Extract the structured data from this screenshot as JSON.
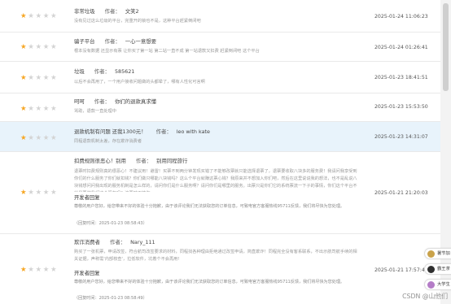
{
  "labels": {
    "author": "作者：",
    "reply_heading": "开发者回复"
  },
  "colors": {
    "star_on": "#f6a623",
    "star_off": "#d3d3d3",
    "highlight": "#e8f3fb"
  },
  "reviews": [
    {
      "rating": 1,
      "title": "非常垃圾",
      "author": "文笑2",
      "body": "没有见过这么垃圾的平台，完重开的锁也不是，这种平台赶紧倒闭吧",
      "date": "2025-01-24 11:06:23"
    },
    {
      "rating": 1,
      "title": "骗子平台",
      "author": "一心一意想要",
      "body": "根本没有数据 还显示有票 让你买了第一站 第二站一直不成 第一站退款又扣费 赶紧倒闭吧 这个平台",
      "date": "2025-01-24 01:26:41"
    },
    {
      "rating": 1,
      "title": "垃圾",
      "author": "585621",
      "body": "以后不会再用了，一个用户接收问题做的头都晕了，哪有人性化可言啊",
      "date": "2025-01-23 18:41:51"
    },
    {
      "rating": 1,
      "title": "呵呵",
      "author": "你们的退款真求懂",
      "body": "骂助，退款一直处理中",
      "date": "2025-01-23 15:53:50"
    },
    {
      "rating": 1,
      "title": "退款机制有问题 还我1300元！",
      "author": "leo with kate",
      "body": "同程退款机制太差，存在欺诈消费者",
      "date": "2025-01-23 14:31:07"
    },
    {
      "rating": 1,
      "title": "扣费规则很恶心！别用",
      "author": "别用同程旅行",
      "body": "退票时扣费规则真的很恶心！不建议用！避雷！买票不到两分钟发现买错了不能够改票就只能选择退票了，退票要收取八块多的服务费！我请问我享受到你们的什么服务了你们就扣钱？你们做只哪能八块钱吗？这么个平台就赚这票心钱？我原来并不想加入你们吧，然后在这里说说我的想法，也不是乱说八块钱想问问我出现的服务机制是怎么样的，请问你们是什么服务啊？请问你们是哪里的服务。出票只是你们它的系统票流一下子的事情，你们这个平台不就是要做我们这个服务吗？流票时不够你",
      "date": "2025-01-21 21:20:03",
      "reply": {
        "body": "尊敬的用户您好，给您带来不好的体验十分抱歉，由于该评论我们无法获取您的订单信息，可致电官方客服热线95711反馈，我们将尽快为您处理。",
        "time": "（回复时间：2025-01-23 08:58:43）"
      }
    },
    {
      "rating": 1,
      "title": "欺诈消费者",
      "author": "Nary_111",
      "body": "购买了一张机票，申请改签，符合航司改签要求的材料，同程找各种理由拒绝通过改签申请，简直欺诈！同程完全没有客系联系，不出示航司航手续的相关证据，声称需'内部核查'，拉低软件，坑着个不会再用!",
      "date": "2025-01-21 17:57:45",
      "reply": {
        "body": "尊敬的用户您好，给您带来不好的体验十分抱歉，由于该评论我们无法获取您的订单信息，可致电官方客服热线95711反馈，我们将尽快为您处理。",
        "time": "（回复时间：2025-01-23 08:58:49）"
      }
    }
  ],
  "side_widgets": [
    {
      "text": "暑节加",
      "avatar_color": "#c9a24a"
    },
    {
      "text": "霸王茶",
      "avatar_color": "#2f2f2f"
    },
    {
      "text": "大学生",
      "avatar_color": "#b47cc7"
    }
  ],
  "watermark": "CSDN @山他们"
}
